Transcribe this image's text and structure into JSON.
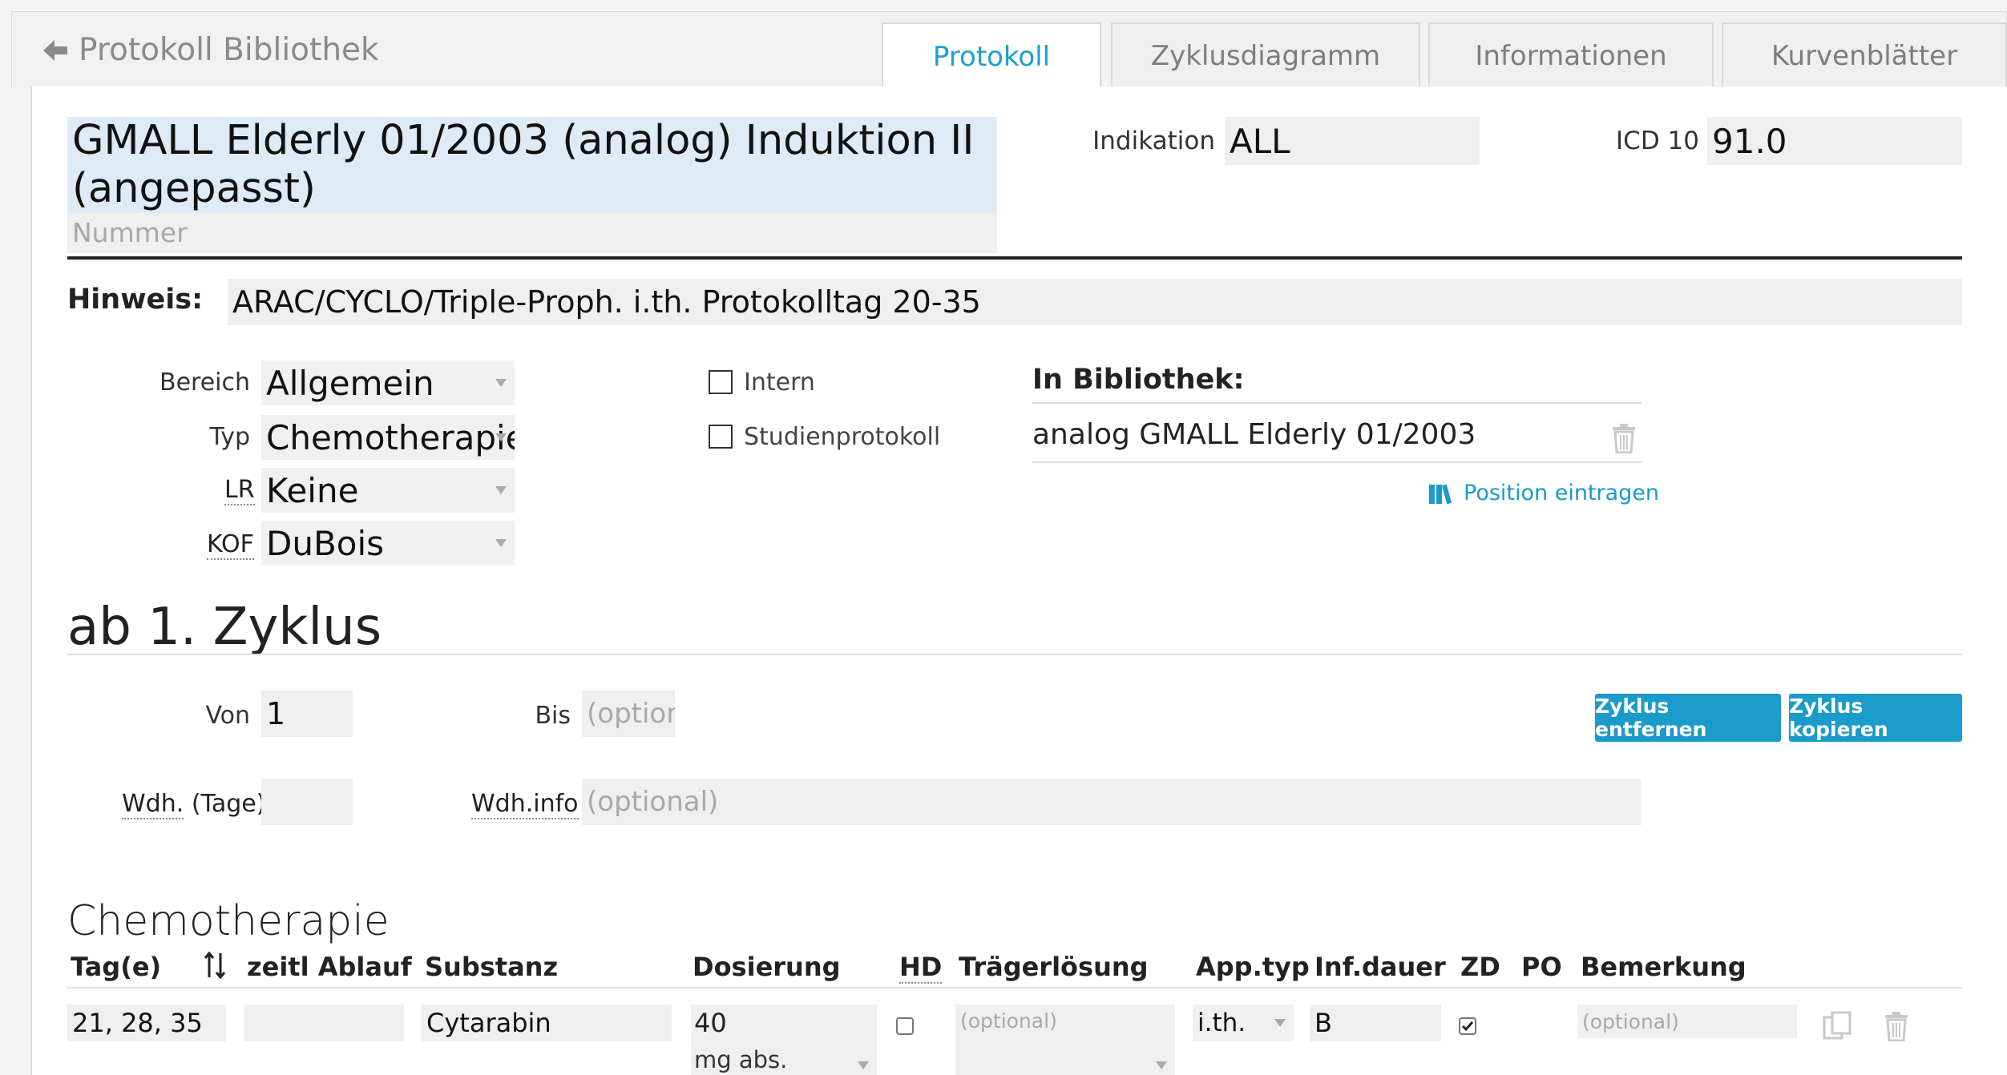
{
  "nav": {
    "back_label": "Protokoll Bibliothek",
    "tabs": [
      {
        "label": "Protokoll",
        "active": true
      },
      {
        "label": "Zyklusdiagramm",
        "active": false
      },
      {
        "label": "Informationen",
        "active": false
      },
      {
        "label": "Kurvenblätter",
        "active": false
      }
    ]
  },
  "header": {
    "title": "GMALL Elderly 01/2003 (analog) Induktion II (angepasst)",
    "number_placeholder": "Nummer",
    "indikation_label": "Indikation",
    "indikation_value": "ALL",
    "icd_label": "ICD 10",
    "icd_value": "91.0"
  },
  "hinweis": {
    "label": "Hinweis:",
    "value": "ARAC/CYCLO/Triple-Proph. i.th. Protokolltag 20-35"
  },
  "meta": {
    "bereich_label": "Bereich",
    "bereich_value": "Allgemein",
    "typ_label": "Typ",
    "typ_value": "Chemotherapie",
    "lr_label": "LR",
    "lr_value": "Keine",
    "kof_label": "KOF",
    "kof_value": "DuBois",
    "intern_label": "Intern",
    "studien_label": "Studienprotokoll",
    "bibliothek_label": "In Bibliothek:",
    "bibliothek_entry": "analog GMALL Elderly 01/2003",
    "position_link": "Position eintragen"
  },
  "zyklus": {
    "heading": "ab 1. Zyklus",
    "von_label": "Von",
    "von_value": "1",
    "bis_label": "Bis",
    "bis_placeholder": "(option",
    "wdh_tage_label": "Wdh.",
    "wdh_tage_suffix": "(Tage)",
    "wdh_info_label": "Wdh.info",
    "wdh_info_placeholder": "(optional)",
    "remove_button": "Zyklus entfernen",
    "copy_button": "Zyklus kopieren"
  },
  "chemo": {
    "heading": "Chemotherapie",
    "columns": {
      "tage": "Tag(e)",
      "zeitl": "zeitl Ablauf",
      "substanz": "Substanz",
      "dosierung": "Dosierung",
      "hd": "HD",
      "traeger": "Trägerlösung",
      "apptyp": "App.typ",
      "infdauer": "Inf.dauer",
      "zd": "ZD",
      "po": "PO",
      "bemerkung": "Bemerkung"
    },
    "row": {
      "tage": "21, 28, 35",
      "zeitl": "",
      "substanz": "Cytarabin",
      "dosis": "40",
      "einheit": "mg abs.",
      "traeger_placeholder": "(optional)",
      "apptyp": "i.th.",
      "infdauer": "B",
      "zd_checked": true,
      "bemerkung_placeholder": "(optional)"
    }
  },
  "colors": {
    "accent": "#1a9bc9",
    "title_bg": "#dfeaf7",
    "field_bg": "#efefef"
  }
}
